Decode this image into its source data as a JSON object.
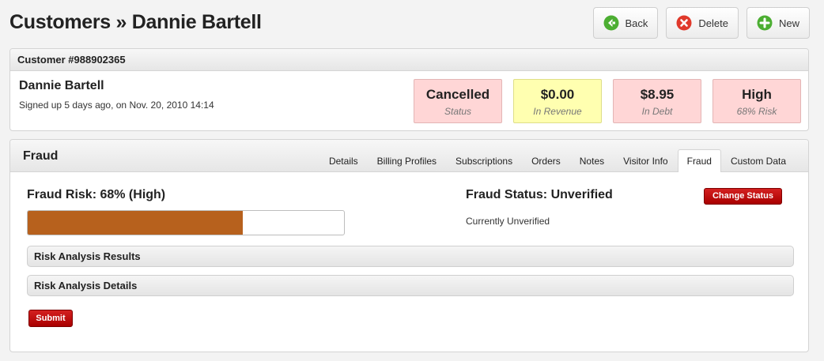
{
  "header": {
    "title": "Customers » Dannie Bartell",
    "buttons": {
      "back": "Back",
      "delete": "Delete",
      "new": "New"
    }
  },
  "customer": {
    "panel_title": "Customer #988902365",
    "name": "Dannie Bartell",
    "signup": "Signed up 5 days ago, on Nov. 20, 2010 14:14",
    "stats": [
      {
        "value": "Cancelled",
        "label": "Status"
      },
      {
        "value": "$0.00",
        "label": "In Revenue"
      },
      {
        "value": "$8.95",
        "label": "In Debt"
      },
      {
        "value": "High",
        "label": "68% Risk"
      }
    ]
  },
  "fraud": {
    "panel_title": "Fraud",
    "tabs": [
      "Details",
      "Billing Profiles",
      "Subscriptions",
      "Orders",
      "Notes",
      "Visitor Info",
      "Fraud",
      "Custom Data"
    ],
    "active_tab": "Fraud",
    "risk_title": "Fraud Risk: 68% (High)",
    "risk_level": 0.68,
    "status_title": "Fraud Status: Unverified",
    "status_sub": "Currently Unverified",
    "change_status_label": "Change Status",
    "sections": [
      "Risk Analysis Results",
      "Risk Analysis Details"
    ],
    "submit_label": "Submit"
  },
  "colors": {
    "risk_fill": "#b7611d",
    "danger_button": "#c00000",
    "stat_red": "#ffd6d6",
    "stat_yellow": "#ffffb0"
  },
  "icons": {
    "back": "back-arrow-icon",
    "delete": "delete-x-icon",
    "new": "add-plus-icon"
  }
}
